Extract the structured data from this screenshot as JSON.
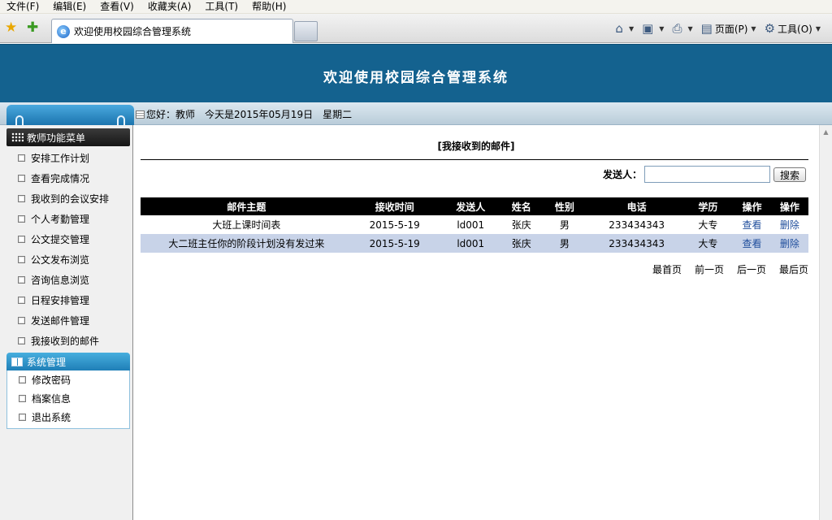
{
  "browser": {
    "menu": [
      "文件(F)",
      "编辑(E)",
      "查看(V)",
      "收藏夹(A)",
      "工具(T)",
      "帮助(H)"
    ],
    "tab_title": "欢迎使用校园综合管理系统",
    "commands": {
      "page": "页面(P)",
      "tools": "工具(O)"
    }
  },
  "site": {
    "title": "欢迎使用校园综合管理系统",
    "greeting": "您好：教师　今天是2015年05月19日　星期二"
  },
  "sidebar": {
    "section1_title": "教师功能菜单",
    "section1_items": [
      "安排工作计划",
      "查看完成情况",
      "我收到的会议安排",
      "个人考勤管理",
      "公文提交管理",
      "公文发布浏览",
      "咨询信息浏览",
      "日程安排管理",
      "发送邮件管理",
      "我接收到的邮件"
    ],
    "section2_title": "系统管理",
    "section2_items": [
      "修改密码",
      "档案信息",
      "退出系统"
    ]
  },
  "main": {
    "title": "[我接收到的邮件]",
    "search_label": "发送人：",
    "search_value": "",
    "search_button": "搜索",
    "columns": [
      "邮件主题",
      "接收时间",
      "发送人",
      "姓名",
      "性别",
      "电话",
      "学历",
      "操作",
      "操作"
    ],
    "rows": [
      {
        "subject": "大班上课时间表",
        "time": "2015-5-19",
        "sender": "ld001",
        "name": "张庆",
        "gender": "男",
        "phone": "233434343",
        "edu": "大专",
        "view": "查看",
        "del": "删除"
      },
      {
        "subject": "大二班主任你的阶段计划没有发过来",
        "time": "2015-5-19",
        "sender": "ld001",
        "name": "张庆",
        "gender": "男",
        "phone": "233434343",
        "edu": "大专",
        "view": "查看",
        "del": "删除"
      }
    ],
    "pager": [
      "最首页",
      "前一页",
      "后一页",
      "最后页"
    ]
  },
  "colors": {
    "banner": "#14628f",
    "table_header": "#000000",
    "row_highlight": "#c8d3e8",
    "link": "#1f4e9c"
  }
}
